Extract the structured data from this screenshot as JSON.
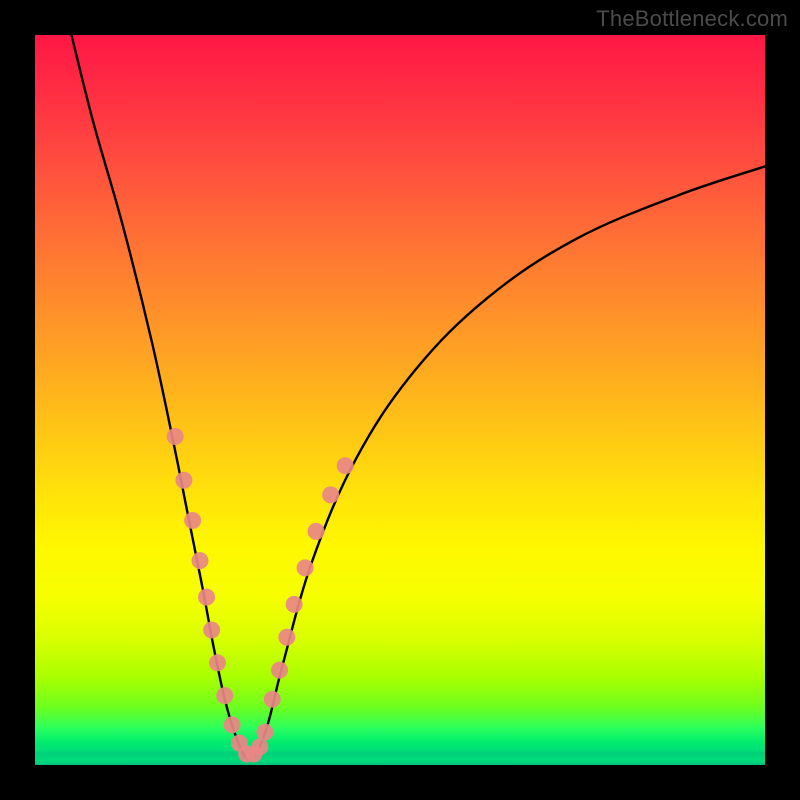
{
  "watermark": "TheBottleneck.com",
  "chart_data": {
    "type": "line",
    "title": "",
    "xlabel": "",
    "ylabel": "",
    "xlim": [
      0,
      100
    ],
    "ylim": [
      0,
      100
    ],
    "series": [
      {
        "name": "bottleneck-curve",
        "x": [
          5,
          8,
          12,
          16,
          19,
          21,
          23,
          24.5,
          26,
          27.5,
          29,
          30.5,
          32,
          34,
          38,
          44,
          52,
          62,
          74,
          88,
          100
        ],
        "y": [
          100,
          88,
          74,
          58,
          44,
          34,
          24,
          16,
          9,
          4,
          1,
          2,
          6,
          14,
          28,
          42,
          54,
          64,
          72,
          78,
          82
        ]
      }
    ],
    "markers": [
      {
        "name": "left-branch-dots",
        "x": [
          19.2,
          20.4,
          21.6,
          22.6,
          23.5,
          24.2,
          25.0,
          26.0,
          27.0,
          28.0,
          29.0,
          30.0,
          30.8,
          31.5
        ],
        "y": [
          45.0,
          39.0,
          33.5,
          28.0,
          23.0,
          18.5,
          14.0,
          9.5,
          5.5,
          3.0,
          1.5,
          1.5,
          2.5,
          4.5
        ]
      },
      {
        "name": "right-branch-dots",
        "x": [
          32.5,
          33.5,
          34.5,
          35.5,
          37.0,
          38.5,
          40.5,
          42.5
        ],
        "y": [
          9.0,
          13.0,
          17.5,
          22.0,
          27.0,
          32.0,
          37.0,
          41.0
        ]
      }
    ],
    "gradient_stops": [
      {
        "pct": 0,
        "color": "#ff1745"
      },
      {
        "pct": 26,
        "color": "#ff6a37"
      },
      {
        "pct": 55,
        "color": "#ffc814"
      },
      {
        "pct": 77,
        "color": "#f6ff00"
      },
      {
        "pct": 92,
        "color": "#6fff1e"
      },
      {
        "pct": 100,
        "color": "#00c07e"
      }
    ]
  }
}
